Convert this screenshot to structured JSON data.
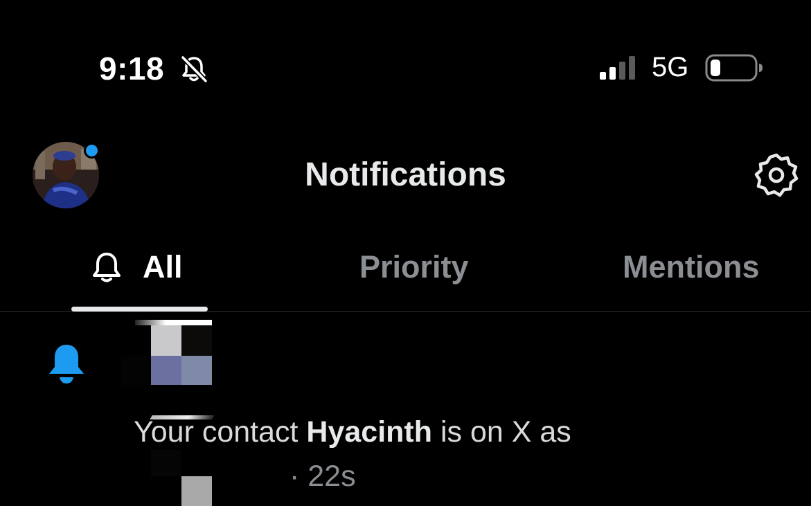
{
  "status_bar": {
    "time": "9:18",
    "network": "5G",
    "icons": [
      "mute-bell-icon",
      "cellular-signal-icon",
      "battery-icon"
    ]
  },
  "header": {
    "title": "Notifications",
    "settings_icon": "gear-icon",
    "avatar_badge_color": "#1d9bf0"
  },
  "tabs": [
    {
      "label": "All",
      "icon": "bell-outline-icon",
      "selected": true
    },
    {
      "label": "Priority",
      "selected": false
    },
    {
      "label": "Mentions",
      "selected": false
    }
  ],
  "notification": {
    "icon": "bell-filled-icon",
    "icon_color": "#1d9bf0",
    "text_prefix": "Your contact ",
    "contact_name": "Hyacinth",
    "text_suffix": " is on X as",
    "time": "· 22s"
  },
  "colors": {
    "background": "#000000",
    "accent": "#1d9bf0",
    "primary_text": "#e7e9ea",
    "secondary_text": "#8b8f93",
    "divider": "#2f3336"
  }
}
